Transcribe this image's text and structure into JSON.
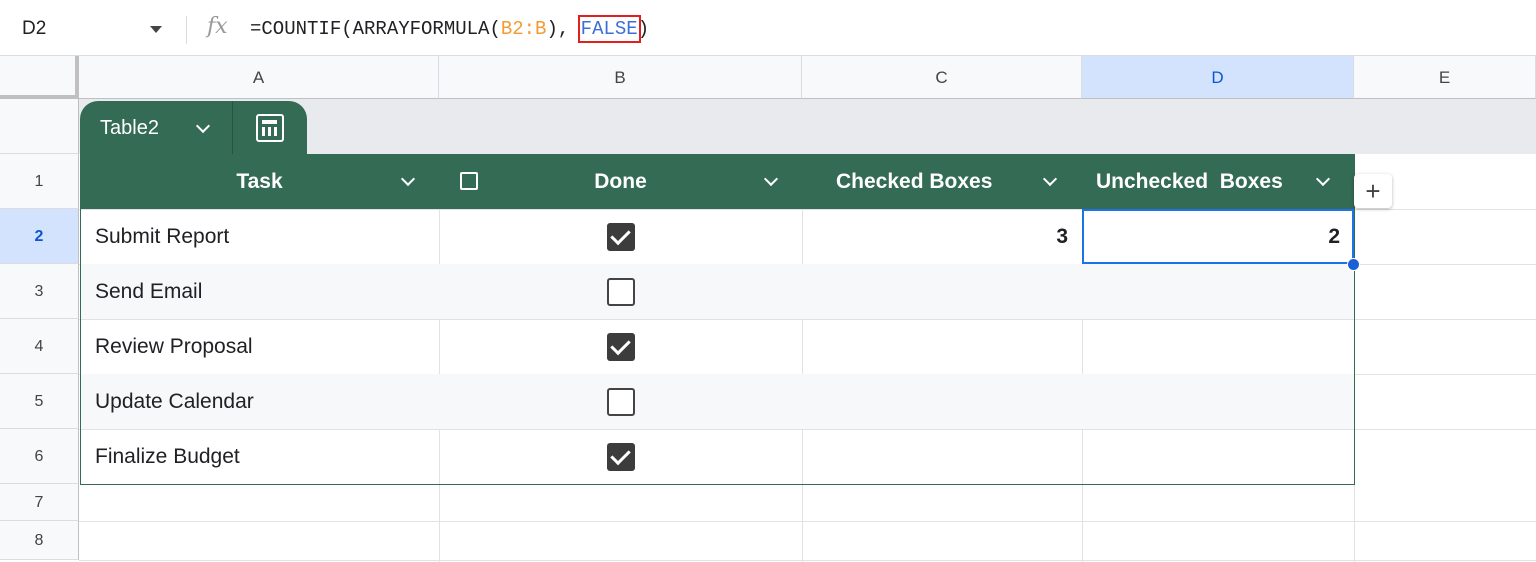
{
  "formula_bar": {
    "name_box": "D2",
    "fx": "fx",
    "formula_prefix": "=COUNTIF(ARRAYFORMULA(",
    "formula_range": "B2:B",
    "formula_mid": "), ",
    "formula_false": "FALSE",
    "formula_suffix": ")"
  },
  "columns": [
    "A",
    "B",
    "C",
    "D",
    "E"
  ],
  "rows": [
    "1",
    "2",
    "3",
    "4",
    "5",
    "6",
    "7",
    "8"
  ],
  "table": {
    "name": "Table2",
    "headers": [
      "Task",
      "Done",
      "Checked Boxes",
      "Unchecked  Boxes"
    ],
    "tasks": [
      "Submit Report",
      "Send Email",
      "Review Proposal",
      "Update Calendar",
      "Finalize Budget"
    ],
    "done": [
      true,
      false,
      true,
      false,
      true
    ],
    "checked_count": "3",
    "unchecked_count": "2"
  },
  "colors": {
    "header": "#336b54",
    "selection": "#1a73e8"
  }
}
